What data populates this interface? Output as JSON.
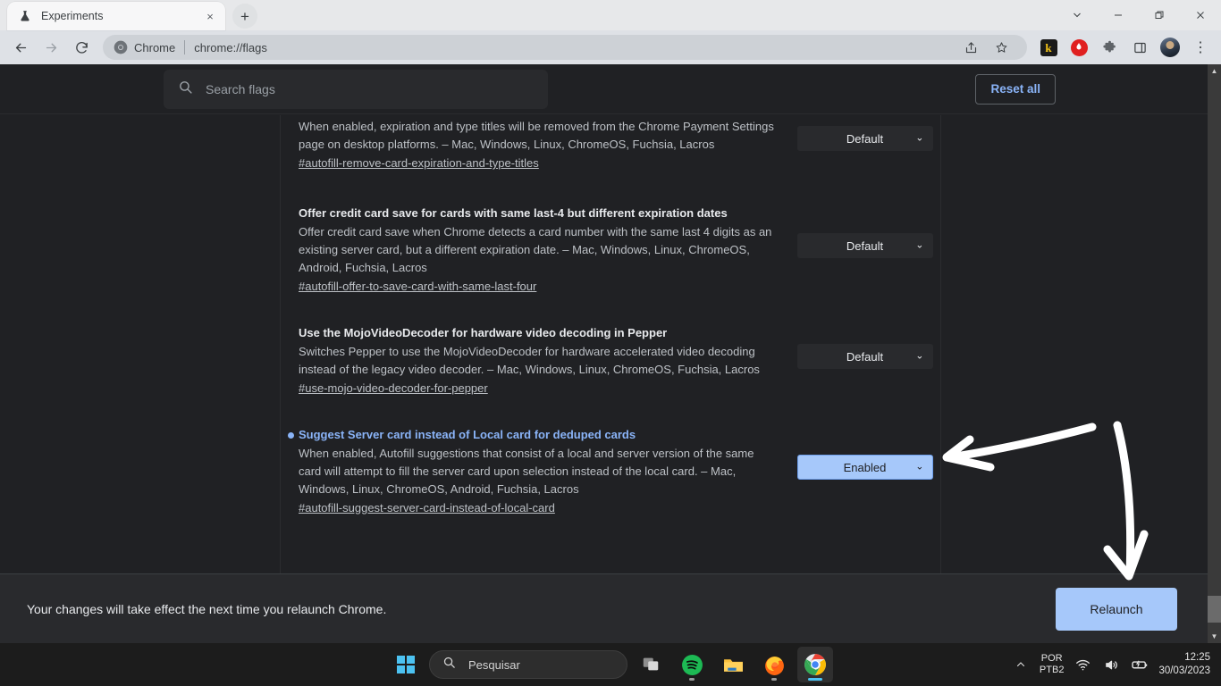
{
  "window": {
    "tab": {
      "title": "Experiments",
      "favicon": "flask-icon",
      "close": "×"
    },
    "new_tab": "+",
    "controls": {
      "tab_search": "⌄",
      "minimize": "—",
      "restore": "❐",
      "close": "✕"
    }
  },
  "toolbar": {
    "back": "←",
    "forward": "→",
    "reload": "⟳",
    "omnibox": {
      "chip_label": "Chrome",
      "url": "chrome://flags",
      "separator": "|"
    },
    "share": "share-icon",
    "bookmark": "star-icon",
    "ext_k": "k",
    "ext_shield": "shield-icon",
    "extensions": "puzzle-icon",
    "side_panel": "side-panel-icon",
    "avatar": "profile-avatar",
    "menu": "⋮"
  },
  "flags_page": {
    "search": {
      "placeholder": "Search flags",
      "value": "",
      "icon": "search-icon"
    },
    "reset_all": "Reset all",
    "select_caret": "⌄",
    "flags": [
      {
        "title": "",
        "modified": false,
        "description": "When enabled, expiration and type titles will be removed from the Chrome Payment Settings page on desktop platforms. – Mac, Windows, Linux, ChromeOS, Fuchsia, Lacros",
        "link": "#autofill-remove-card-expiration-and-type-titles",
        "state": "Default"
      },
      {
        "title": "Offer credit card save for cards with same last-4 but different expiration dates",
        "modified": false,
        "description": "Offer credit card save when Chrome detects a card number with the same last 4 digits as an existing server card, but a different expiration date. – Mac, Windows, Linux, ChromeOS, Android, Fuchsia, Lacros",
        "link": "#autofill-offer-to-save-card-with-same-last-four",
        "state": "Default"
      },
      {
        "title": "Use the MojoVideoDecoder for hardware video decoding in Pepper",
        "modified": false,
        "description": "Switches Pepper to use the MojoVideoDecoder for hardware accelerated video decoding instead of the legacy video decoder. – Mac, Windows, Linux, ChromeOS, Fuchsia, Lacros",
        "link": "#use-mojo-video-decoder-for-pepper",
        "state": "Default"
      },
      {
        "title": "Suggest Server card instead of Local card for deduped cards",
        "modified": true,
        "description": "When enabled, Autofill suggestions that consist of a local and server version of the same card will attempt to fill the server card upon selection instead of the local card. – Mac, Windows, Linux, ChromeOS, Android, Fuchsia, Lacros",
        "link": "#autofill-suggest-server-card-instead-of-local-card",
        "state": "Enabled"
      }
    ]
  },
  "relaunch_bar": {
    "note": "Your changes will take effect the next time you relaunch Chrome.",
    "button": "Relaunch"
  },
  "taskbar": {
    "start": "windows-start-icon",
    "search_placeholder": "Pesquisar",
    "apps": [
      {
        "name": "task-view-icon"
      },
      {
        "name": "spotify-icon"
      },
      {
        "name": "file-explorer-icon"
      },
      {
        "name": "firefox-icon"
      },
      {
        "name": "chrome-icon"
      }
    ],
    "tray": {
      "overflow": "⌃",
      "keyboard_line1": "POR",
      "keyboard_line2": "PTB2",
      "wifi": "wifi-icon",
      "volume": "volume-icon",
      "battery": "battery-icon",
      "time": "12:25",
      "date": "30/03/2023"
    }
  },
  "colors": {
    "page_bg": "#202124",
    "card_bg": "#292a2d",
    "accent_blue": "#8ab4f8",
    "enabled_bg": "#a6c8fa",
    "text_primary": "#e8eaed",
    "text_secondary": "#bdc1c6"
  }
}
